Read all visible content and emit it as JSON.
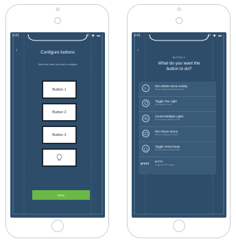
{
  "left_screen": {
    "status_time": "9:41",
    "status_icons": "..ll ◆ ▬",
    "back_icon": "chevron-left",
    "title": "Configure buttons",
    "subtitle": "Select the button you want to configure",
    "buttons": [
      "Button 1",
      "Button 2",
      "Button 3"
    ],
    "lightbulb_icon": "lightbulb",
    "done_label": "Done"
  },
  "right_screen": {
    "status_time": "9:41",
    "status_icons": "..ll ◆ ▬",
    "back_icon": "chevron-left",
    "heading": "BUTTON 1",
    "title_line1": "What do you want the",
    "title_line2": "button to do?",
    "actions": [
      {
        "icon": "play-icon",
        "title": "Run Whole Home Activity",
        "subtitle": "Run an existing whole home activity"
      },
      {
        "icon": "lightbulb-icon",
        "title": "Toggle One Light",
        "subtitle": "Turn a light on or off"
      },
      {
        "icon": "multi-light-icon",
        "title": "Control Multiple Lights",
        "subtitle": "Turn a group of lights on or off"
      },
      {
        "icon": "scene-icon",
        "title": "Run Room Scene",
        "subtitle": "Run an existing room scene"
      },
      {
        "icon": "home-away-icon",
        "title": "Toggle Home/Away",
        "subtitle": "Set your Home or Away Status"
      },
      {
        "icon": "ifttt-icon",
        "mark": "IFTTT",
        "title": "IFTTT",
        "subtitle": "Trigger an IFTTT applet"
      }
    ]
  },
  "colors": {
    "screen_bg": "#2d4d6b",
    "list_bg": "#3a5b78",
    "done_green": "#6ab947"
  }
}
